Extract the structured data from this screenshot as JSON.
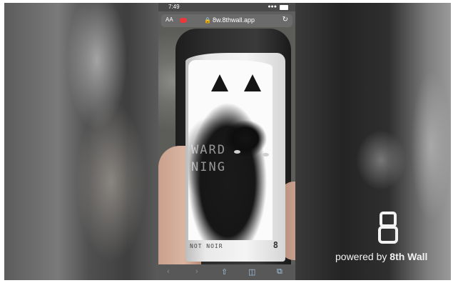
{
  "status_bar": {
    "time": "7:49"
  },
  "browser": {
    "text_size_label": "AA",
    "url": "8w.8thwall.app",
    "reload_icon": "reload-icon"
  },
  "wine_label": {
    "line1": "WARD",
    "line2": "NING",
    "variety": "NOT NOIR",
    "number": "8"
  },
  "toolbar": {
    "icons": [
      "back-icon",
      "forward-icon",
      "share-icon",
      "bookmarks-icon",
      "tabs-icon"
    ]
  },
  "branding": {
    "prefix": "powered by",
    "name": "8th Wall",
    "logo_glyph": "8"
  }
}
